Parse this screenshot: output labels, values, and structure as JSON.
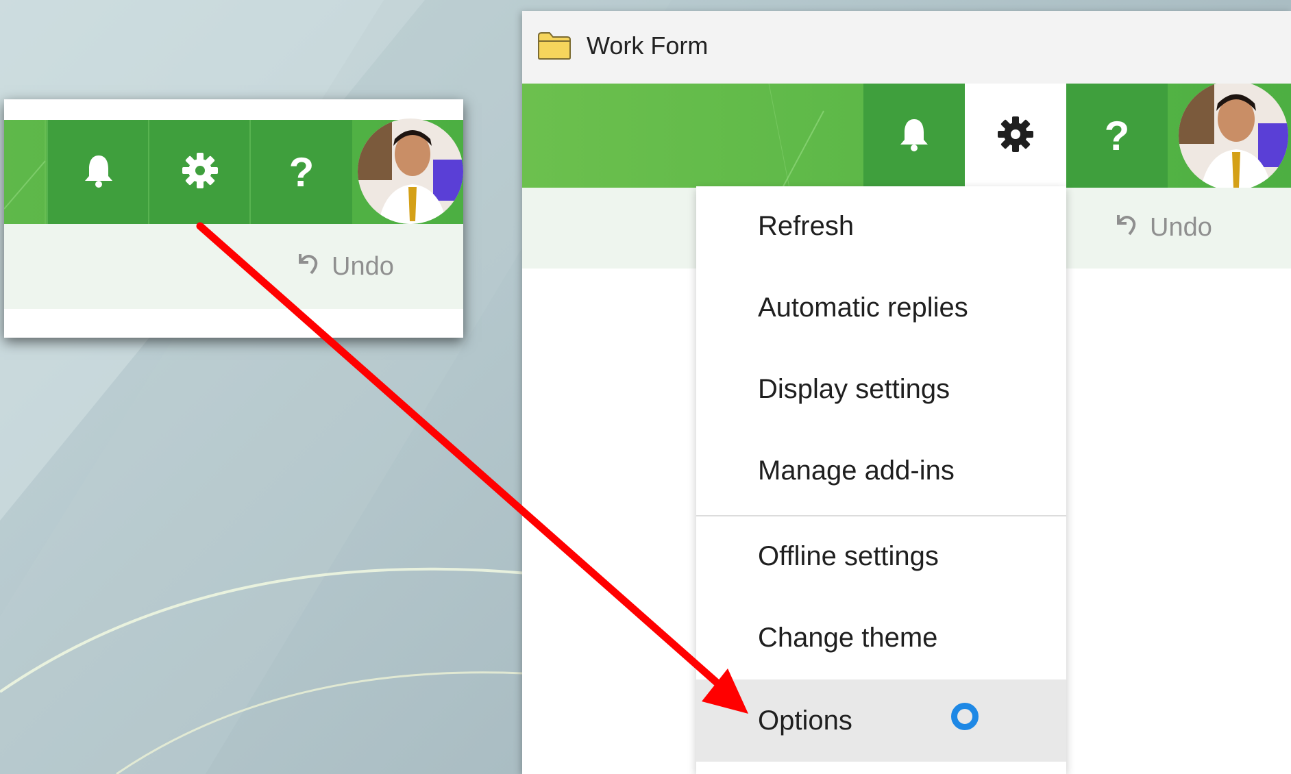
{
  "window": {
    "title": "Work Form",
    "folder_icon": "folder-icon"
  },
  "header": {
    "bell_icon": "bell-icon",
    "gear_icon": "gear-icon",
    "help_label": "?",
    "avatar": "avatar"
  },
  "toolbar": {
    "undo_label": "Undo",
    "undo_icon": "undo-icon"
  },
  "settings_menu": {
    "items": [
      {
        "label": "Refresh"
      },
      {
        "label": "Automatic replies"
      },
      {
        "label": "Display settings"
      },
      {
        "label": "Manage add-ins"
      },
      {
        "label": "Offline settings"
      },
      {
        "label": "Change theme"
      },
      {
        "label": "Options"
      }
    ],
    "selected_index": 6
  },
  "snippet": {
    "help_label": "?",
    "undo_label": "Undo"
  },
  "colors": {
    "header_green": "#5db848",
    "button_green": "#3f9f3d",
    "arrow_red": "#ff0000",
    "spinner_blue": "#1e88e5"
  }
}
